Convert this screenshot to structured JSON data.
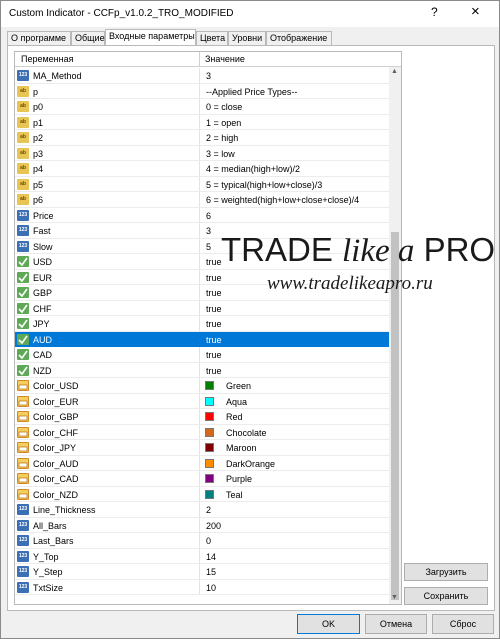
{
  "window": {
    "title": "Custom Indicator - CCFp_v1.0.2_TRO_MODIFIED",
    "help": "?",
    "close": "×"
  },
  "tabs": [
    "О программе",
    "Общие",
    "Входные параметры",
    "Цвета",
    "Уровни",
    "Отображение"
  ],
  "active_tab": 2,
  "grid": {
    "col_name": "Переменная",
    "col_value": "Значение",
    "rows": [
      {
        "icon": "123",
        "type": "num",
        "name": "MA_Method",
        "value": "3"
      },
      {
        "icon": "ab",
        "type": "str",
        "name": "p",
        "value": "--Applied Price Types--"
      },
      {
        "icon": "ab",
        "type": "str",
        "name": "p0",
        "value": "0 = close"
      },
      {
        "icon": "ab",
        "type": "str",
        "name": "p1",
        "value": "1 = open"
      },
      {
        "icon": "ab",
        "type": "str",
        "name": "p2",
        "value": "2 = high"
      },
      {
        "icon": "ab",
        "type": "str",
        "name": "p3",
        "value": "3 = low"
      },
      {
        "icon": "ab",
        "type": "str",
        "name": "p4",
        "value": "4 = median(high+low)/2"
      },
      {
        "icon": "ab",
        "type": "str",
        "name": "p5",
        "value": "5 = typical(high+low+close)/3"
      },
      {
        "icon": "ab",
        "type": "str",
        "name": "p6",
        "value": "6 = weighted(high+low+close+close)/4"
      },
      {
        "icon": "123",
        "type": "num",
        "name": "Price",
        "value": "6"
      },
      {
        "icon": "123",
        "type": "num",
        "name": "Fast",
        "value": "3"
      },
      {
        "icon": "123",
        "type": "num",
        "name": "Slow",
        "value": "5"
      },
      {
        "icon": "",
        "type": "bool",
        "name": "USD",
        "value": "true"
      },
      {
        "icon": "",
        "type": "bool",
        "name": "EUR",
        "value": "true"
      },
      {
        "icon": "",
        "type": "bool",
        "name": "GBP",
        "value": "true"
      },
      {
        "icon": "",
        "type": "bool",
        "name": "CHF",
        "value": "true"
      },
      {
        "icon": "",
        "type": "bool",
        "name": "JPY",
        "value": "true"
      },
      {
        "icon": "",
        "type": "bool",
        "name": "AUD",
        "value": "true",
        "selected": true
      },
      {
        "icon": "",
        "type": "bool",
        "name": "CAD",
        "value": "true"
      },
      {
        "icon": "",
        "type": "bool",
        "name": "NZD",
        "value": "true"
      },
      {
        "icon": "",
        "type": "col",
        "name": "Color_USD",
        "value": "Green",
        "swatch": "#008000"
      },
      {
        "icon": "",
        "type": "col",
        "name": "Color_EUR",
        "value": "Aqua",
        "swatch": "#00ffff"
      },
      {
        "icon": "",
        "type": "col",
        "name": "Color_GBP",
        "value": "Red",
        "swatch": "#ff0000"
      },
      {
        "icon": "",
        "type": "col",
        "name": "Color_CHF",
        "value": "Chocolate",
        "swatch": "#d2691e"
      },
      {
        "icon": "",
        "type": "col",
        "name": "Color_JPY",
        "value": "Maroon",
        "swatch": "#800000"
      },
      {
        "icon": "",
        "type": "col",
        "name": "Color_AUD",
        "value": "DarkOrange",
        "swatch": "#ff8c00"
      },
      {
        "icon": "",
        "type": "col",
        "name": "Color_CAD",
        "value": "Purple",
        "swatch": "#800080"
      },
      {
        "icon": "",
        "type": "col",
        "name": "Color_NZD",
        "value": "Teal",
        "swatch": "#008080"
      },
      {
        "icon": "123",
        "type": "num",
        "name": "Line_Thickness",
        "value": "2"
      },
      {
        "icon": "123",
        "type": "num",
        "name": "All_Bars",
        "value": "200"
      },
      {
        "icon": "123",
        "type": "num",
        "name": "Last_Bars",
        "value": "0"
      },
      {
        "icon": "123",
        "type": "num",
        "name": "Y_Top",
        "value": "14"
      },
      {
        "icon": "123",
        "type": "num",
        "name": "Y_Step",
        "value": "15"
      },
      {
        "icon": "123",
        "type": "num",
        "name": "TxtSize",
        "value": "10"
      }
    ]
  },
  "side_buttons": {
    "load": "Загрузить",
    "save": "Сохранить"
  },
  "buttons": {
    "ok": "OK",
    "cancel": "Отмена",
    "reset": "Сброс"
  },
  "watermark": {
    "brand_a": "TRADE",
    "brand_b": "like a",
    "brand_c": "PRO",
    "url": "www.tradelikeapro.ru"
  },
  "colors": {
    "selection": "#0078d7"
  }
}
